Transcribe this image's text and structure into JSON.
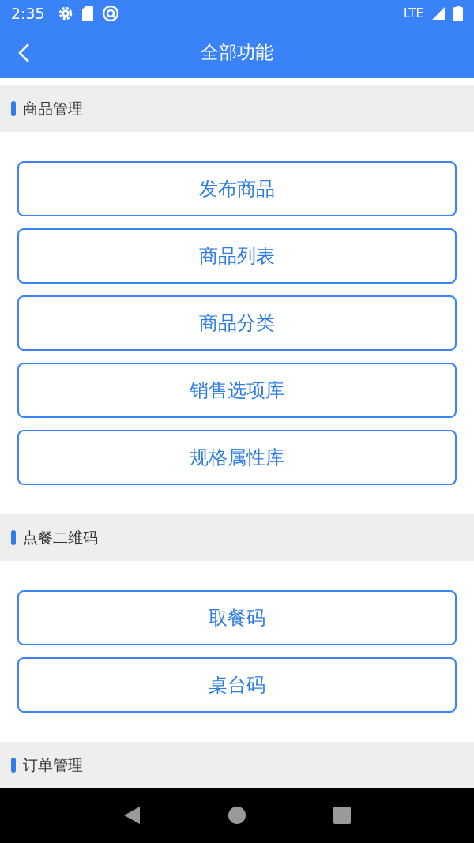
{
  "status_bar": {
    "time": "2:35",
    "network": "LTE"
  },
  "header": {
    "title": "全部功能"
  },
  "sections": [
    {
      "title": "商品管理",
      "buttons": [
        "发布商品",
        "商品列表",
        "商品分类",
        "销售选项库",
        "规格属性库"
      ]
    },
    {
      "title": "点餐二维码",
      "buttons": [
        "取餐码",
        "桌台码"
      ]
    },
    {
      "title": "订单管理"
    }
  ]
}
